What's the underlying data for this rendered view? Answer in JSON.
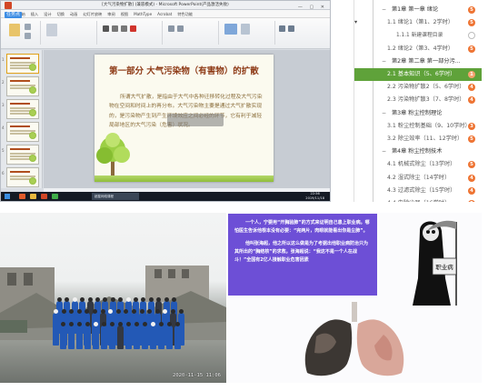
{
  "ppt_window": {
    "stamp": "任务点",
    "title_text": "[大气污染物扩散] (兼容模式) - Microsoft PowerPoint(产品激活失败)",
    "menu": [
      "文件",
      "开始",
      "插入",
      "设计",
      "切换",
      "动画",
      "幻灯片放映",
      "审阅",
      "视图",
      "MathType",
      "Acrobat",
      "特色功能"
    ],
    "slide": {
      "title": "第一部分  大气污染物（有害物）的扩散",
      "body": "所谓大气扩散，是指由于大气中各种迁移转化过程及大气污染物在空间和时间上的再分布。大气污染物主要是通过大气扩散实现的，是污染物产生到产生环境效应之间必经的环节，它有利于减轻局部地区的大气污染（危害）状况。"
    },
    "thumbnail_numbers": [
      "1",
      "2",
      "3",
      "4",
      "5",
      "6"
    ],
    "taskbar": {
      "app_label": "超星网络课程",
      "time": "22:56",
      "date": "2019/11/18"
    }
  },
  "outline": {
    "items": [
      {
        "kind": "chapter",
        "label": "第1章 第一章 绪论",
        "toggle": "−",
        "badge": "5",
        "badge_style": "filled"
      },
      {
        "kind": "lesson",
        "label": "1.1 绪论1（第1、2学时）",
        "toggle": "▾",
        "badge": "5",
        "badge_style": "filled"
      },
      {
        "kind": "sub",
        "label": "1.1.1 新建课程目录",
        "badge": "",
        "badge_style": "empty"
      },
      {
        "kind": "lesson",
        "label": "1.2 绪论2（第3、4学时）",
        "badge": "5",
        "badge_style": "filled"
      },
      {
        "kind": "chapter",
        "label": "第2章 第二章 第一部分污...",
        "toggle": "−",
        "badge": "",
        "badge_style": "none"
      },
      {
        "kind": "lesson",
        "label": "2.1 基本知识（5、6学时）",
        "badge": "1",
        "badge_style": "light",
        "active": true
      },
      {
        "kind": "lesson",
        "label": "2.2 污染物扩散2（5、6学时）",
        "badge": "4",
        "badge_style": "filled"
      },
      {
        "kind": "lesson",
        "label": "2.3 污染物扩散3（7、8学时）",
        "badge": "4",
        "badge_style": "filled"
      },
      {
        "kind": "chapter",
        "label": "第3章 粉尘控制理论",
        "toggle": "−",
        "badge": "",
        "badge_style": "none"
      },
      {
        "kind": "lesson",
        "label": "3.1 粉尘控制基础（9、10学时）",
        "badge": "3",
        "badge_style": "filled"
      },
      {
        "kind": "lesson",
        "label": "3.2 除尘效率（11、12学时）",
        "badge": "5",
        "badge_style": "filled"
      },
      {
        "kind": "chapter",
        "label": "第4章 粉尘控制技术",
        "toggle": "−",
        "badge": "",
        "badge_style": "none"
      },
      {
        "kind": "lesson",
        "label": "4.1 机械式除尘（13学时）",
        "badge": "5",
        "badge_style": "filled"
      },
      {
        "kind": "lesson",
        "label": "4.2 湿式除尘（14学时）",
        "badge": "4",
        "badge_style": "filled"
      },
      {
        "kind": "lesson",
        "label": "4.3 过滤式除尘（15学时）",
        "badge": "4",
        "badge_style": "filled"
      },
      {
        "kind": "lesson",
        "label": "4.4 电除尘器（16学时）",
        "badge": "5",
        "badge_style": "filled"
      },
      {
        "kind": "chapter",
        "label": "第5章 第5章 第三部分 噪声...",
        "toggle": "−",
        "badge": "",
        "badge_style": "none"
      },
      {
        "kind": "lesson",
        "label": "5.1 噪声（17、18学时）",
        "badge": "",
        "badge_style": "none"
      }
    ],
    "colors": {
      "active": "#5fa23a",
      "badge": "#ee7433"
    }
  },
  "photo": {
    "date_stamp": "2020-11-15 11:06"
  },
  "quote_slide": {
    "para1": "一个人，宁要用“开胸验肺”的方式来证明自己患上职业病。哪怕医生告诉他根本没有必要：“完两片，肉眼就能看出你是尘肺”。",
    "para2": "他叫张海超，他之所以这么做是为了考据出他职业病防治只为其所出的“胸结核”的求救。张海超说：“我这不是一个人在战斗！”全国有2亿人接触职业危害因素",
    "reaper_sign": "职业病",
    "colors": {
      "panel": "#6d4fd6"
    }
  }
}
